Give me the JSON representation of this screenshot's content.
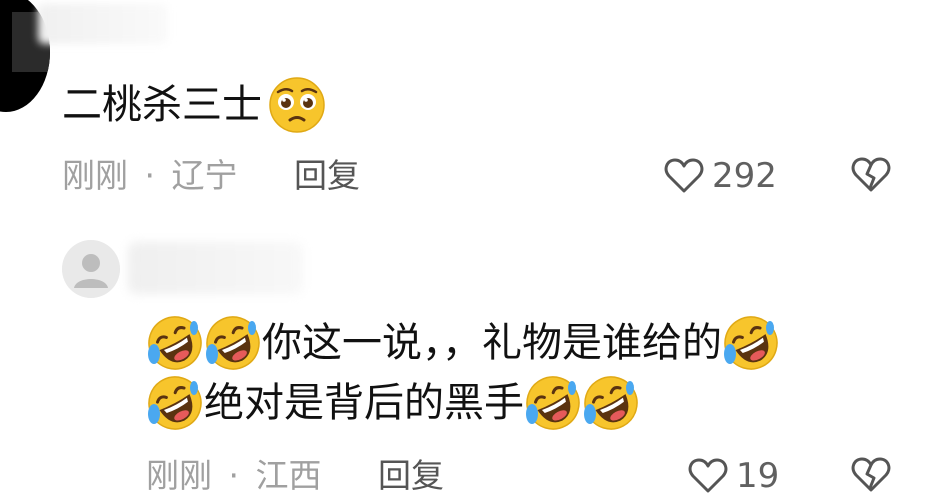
{
  "comments": [
    {
      "text": "二桃杀三士",
      "trailing_emoji": "pleading-face-emoji",
      "time": "刚刚",
      "separator": "·",
      "location": "辽宁",
      "reply_label": "回复",
      "like_count": "292"
    },
    {
      "line1_text": "你这一说，，礼物是谁给的",
      "line2_text": "绝对是背后的黑手",
      "emoji": "rolling-on-floor-laughing-emoji",
      "time": "刚刚",
      "separator": "·",
      "location": "江西",
      "reply_label": "回复",
      "like_count": "19"
    }
  ],
  "icons": {
    "like": "heart-outline-icon",
    "dislike": "broken-heart-icon"
  },
  "colors": {
    "text_primary": "#111111",
    "text_meta": "#a0a0a0",
    "text_reply": "#555555",
    "emoji_yellow": "#f7c52c"
  }
}
